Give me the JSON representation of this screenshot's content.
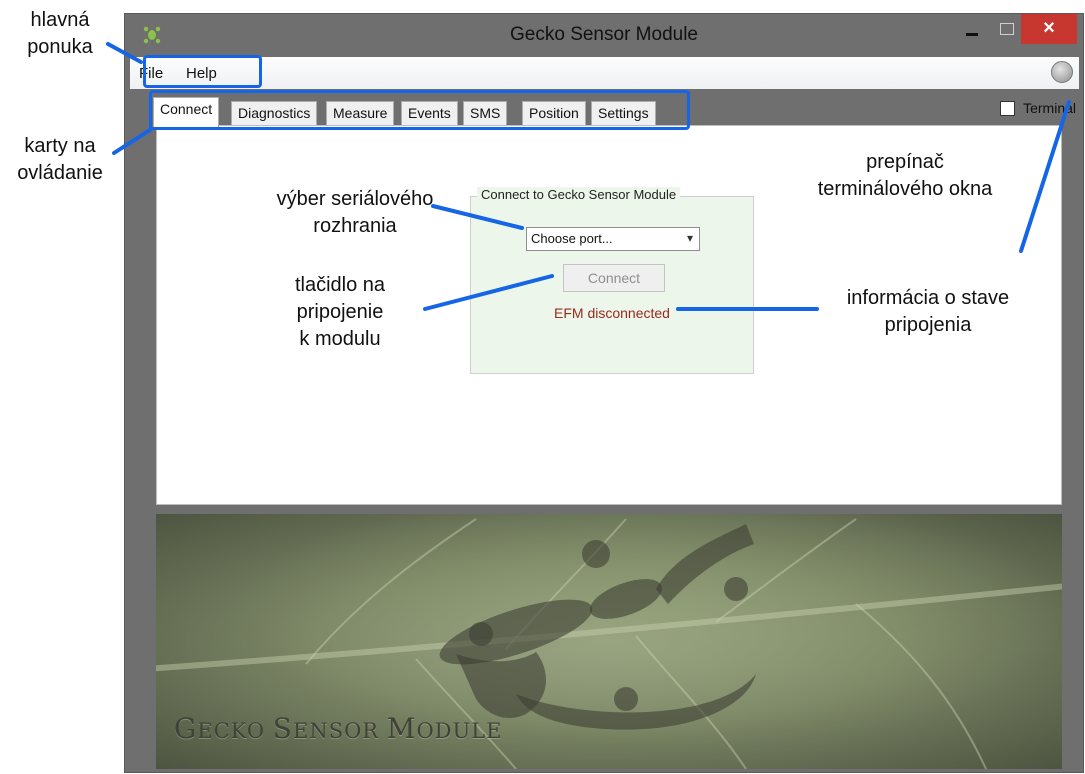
{
  "window": {
    "title": "Gecko Sensor Module",
    "close_glyph": "×"
  },
  "menu": {
    "items": [
      "File",
      "Help"
    ]
  },
  "tabs": [
    "Connect",
    "Diagnostics",
    "Measure",
    "Events",
    "SMS",
    "Position",
    "Settings"
  ],
  "terminal": {
    "label": "Terminal",
    "checked": false
  },
  "connect_panel": {
    "group_title": "Connect to Gecko Sensor Module",
    "port_select_value": "Choose port...",
    "connect_button_label": "Connect",
    "status_text": "EFM disconnected"
  },
  "banner": {
    "first_big": "G",
    "first_rest": "ECKO ",
    "second_big": "S",
    "second_rest": "ENSOR ",
    "third_big": "M",
    "third_rest": "ODULE"
  },
  "annotations": {
    "main_menu": [
      "hlavná",
      "ponuka"
    ],
    "tabs": [
      "karty na",
      "ovládanie"
    ],
    "serial_select": [
      "výber seriálového",
      "rozhrania"
    ],
    "connect_button": [
      "tlačidlo na",
      "pripojenie",
      "k modulu"
    ],
    "terminal_toggle": [
      "prepínač",
      "terminálového okna"
    ],
    "connection_status": [
      "informácia o stave",
      "pripojenia"
    ]
  },
  "colors": {
    "annotation_accent": "#1565e6",
    "status_text": "#9b2a1f",
    "close_button": "#c7372f",
    "group_background": "#ecf6ea"
  },
  "icons": [
    "gecko-app-icon",
    "minimize-icon",
    "maximize-icon",
    "close-icon",
    "status-orb-icon",
    "chevron-down-icon"
  ]
}
